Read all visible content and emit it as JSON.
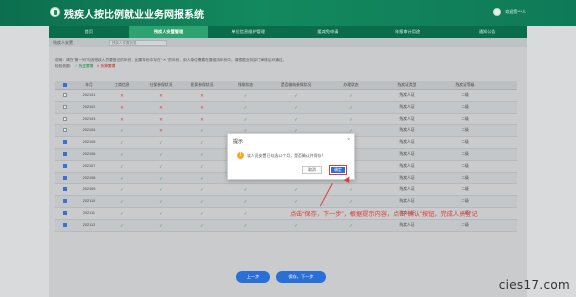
{
  "header": {
    "system_title": "残疾人按比例就业业务网报系统",
    "user_text": "欢迎您***人"
  },
  "nav": {
    "items": [
      "首页",
      "残疾人安置管理",
      "单位信息维护管理",
      "缓减免申请",
      "年报审计用途",
      "通知公告"
    ],
    "active_index": 1
  },
  "subbar": {
    "breadcrumb": "残疾人安置",
    "input_value": "残疾人安置信息"
  },
  "notes": {
    "line1": "说明：请在“第一列”勾选残疾人员要登记的年份，如果年份中存在“ ✕ ”的年份，用人单位需要在要维持年份中，请根据业务部门审核后可通过。",
    "line2_prefix": "检验依据：",
    "line2_ok": "✓ 为正常项",
    "line2_no": "✕ 为异常项"
  },
  "table": {
    "headers": [
      "",
      "年月",
      "工商信息",
      "社保参保状况",
      "医保参保状况",
      "残联状态",
      "是否缴纳参保状况",
      "办理状态",
      "残疾证类型",
      "残疾证等级"
    ],
    "rows": [
      {
        "checked": false,
        "year": "202101",
        "c1": "no",
        "c2": "no",
        "c3": "no",
        "c4": "ok",
        "c5": "ok",
        "c6": "ok",
        "type": "残疾人证",
        "level": "二级"
      },
      {
        "checked": false,
        "year": "202102",
        "c1": "no",
        "c2": "no",
        "c3": "no",
        "c4": "ok",
        "c5": "ok",
        "c6": "ok",
        "type": "残疾人证",
        "level": "二级"
      },
      {
        "checked": false,
        "year": "202103",
        "c1": "no",
        "c2": "no",
        "c3": "no",
        "c4": "ok",
        "c5": "ok",
        "c6": "ok",
        "type": "残疾人证",
        "level": "二级"
      },
      {
        "checked": false,
        "year": "202104",
        "c1": "ok",
        "c2": "no",
        "c3": "ok",
        "c4": "ok",
        "c5": "ok",
        "c6": "ok",
        "type": "残疾人证",
        "level": "二级"
      },
      {
        "checked": true,
        "year": "202105",
        "c1": "ok",
        "c2": "ok",
        "c3": "ok",
        "c4": "ok",
        "c5": "ok",
        "c6": "ok",
        "type": "残疾人证",
        "level": "二级"
      },
      {
        "checked": true,
        "year": "202106",
        "c1": "ok",
        "c2": "ok",
        "c3": "ok",
        "c4": "ok",
        "c5": "ok",
        "c6": "ok",
        "type": "残疾人证",
        "level": "二级"
      },
      {
        "checked": true,
        "year": "202107",
        "c1": "ok",
        "c2": "ok",
        "c3": "ok",
        "c4": "ok",
        "c5": "ok",
        "c6": "ok",
        "type": "残疾人证",
        "level": "二级"
      },
      {
        "checked": true,
        "year": "202108",
        "c1": "ok",
        "c2": "ok",
        "c3": "ok",
        "c4": "ok",
        "c5": "ok",
        "c6": "ok",
        "type": "残疾人证",
        "level": "二级"
      },
      {
        "checked": true,
        "year": "202109",
        "c1": "ok",
        "c2": "ok",
        "c3": "ok",
        "c4": "ok",
        "c5": "ok",
        "c6": "ok",
        "type": "残疾人证",
        "level": "二级"
      },
      {
        "checked": true,
        "year": "202110",
        "c1": "ok",
        "c2": "ok",
        "c3": "ok",
        "c4": "ok",
        "c5": "ok",
        "c6": "ok",
        "type": "残疾人证",
        "level": "二级"
      },
      {
        "checked": true,
        "year": "202111",
        "c1": "ok",
        "c2": "ok",
        "c3": "ok",
        "c4": "ok",
        "c5": "ok",
        "c6": "ok",
        "type": "残疾人证",
        "level": "二级"
      },
      {
        "checked": true,
        "year": "202112",
        "c1": "ok",
        "c2": "ok",
        "c3": "ok",
        "c4": "ok",
        "c5": "ok",
        "c6": "ok",
        "type": "残疾人证",
        "level": "二级"
      }
    ]
  },
  "dialog": {
    "title": "提示",
    "close": "×",
    "icon": "!",
    "message": "该人员安置已勾选12个月，是否确认并保存？",
    "cancel": "取消",
    "ok": "确定"
  },
  "annotation": {
    "text": "点击“保存，下一步”，根据提示内容，点击“确认”按钮，完成人员登记"
  },
  "footer": {
    "prev": "上一步",
    "next": "保存，下一步"
  },
  "watermark": "cies17.com",
  "colors": {
    "brand_green": "#13895f",
    "nav_active": "#2ea26f",
    "primary_blue": "#2a6fd6",
    "annotation_red": "#e03b3b",
    "ok_green": "#3f9c57",
    "no_red": "#d04545"
  }
}
